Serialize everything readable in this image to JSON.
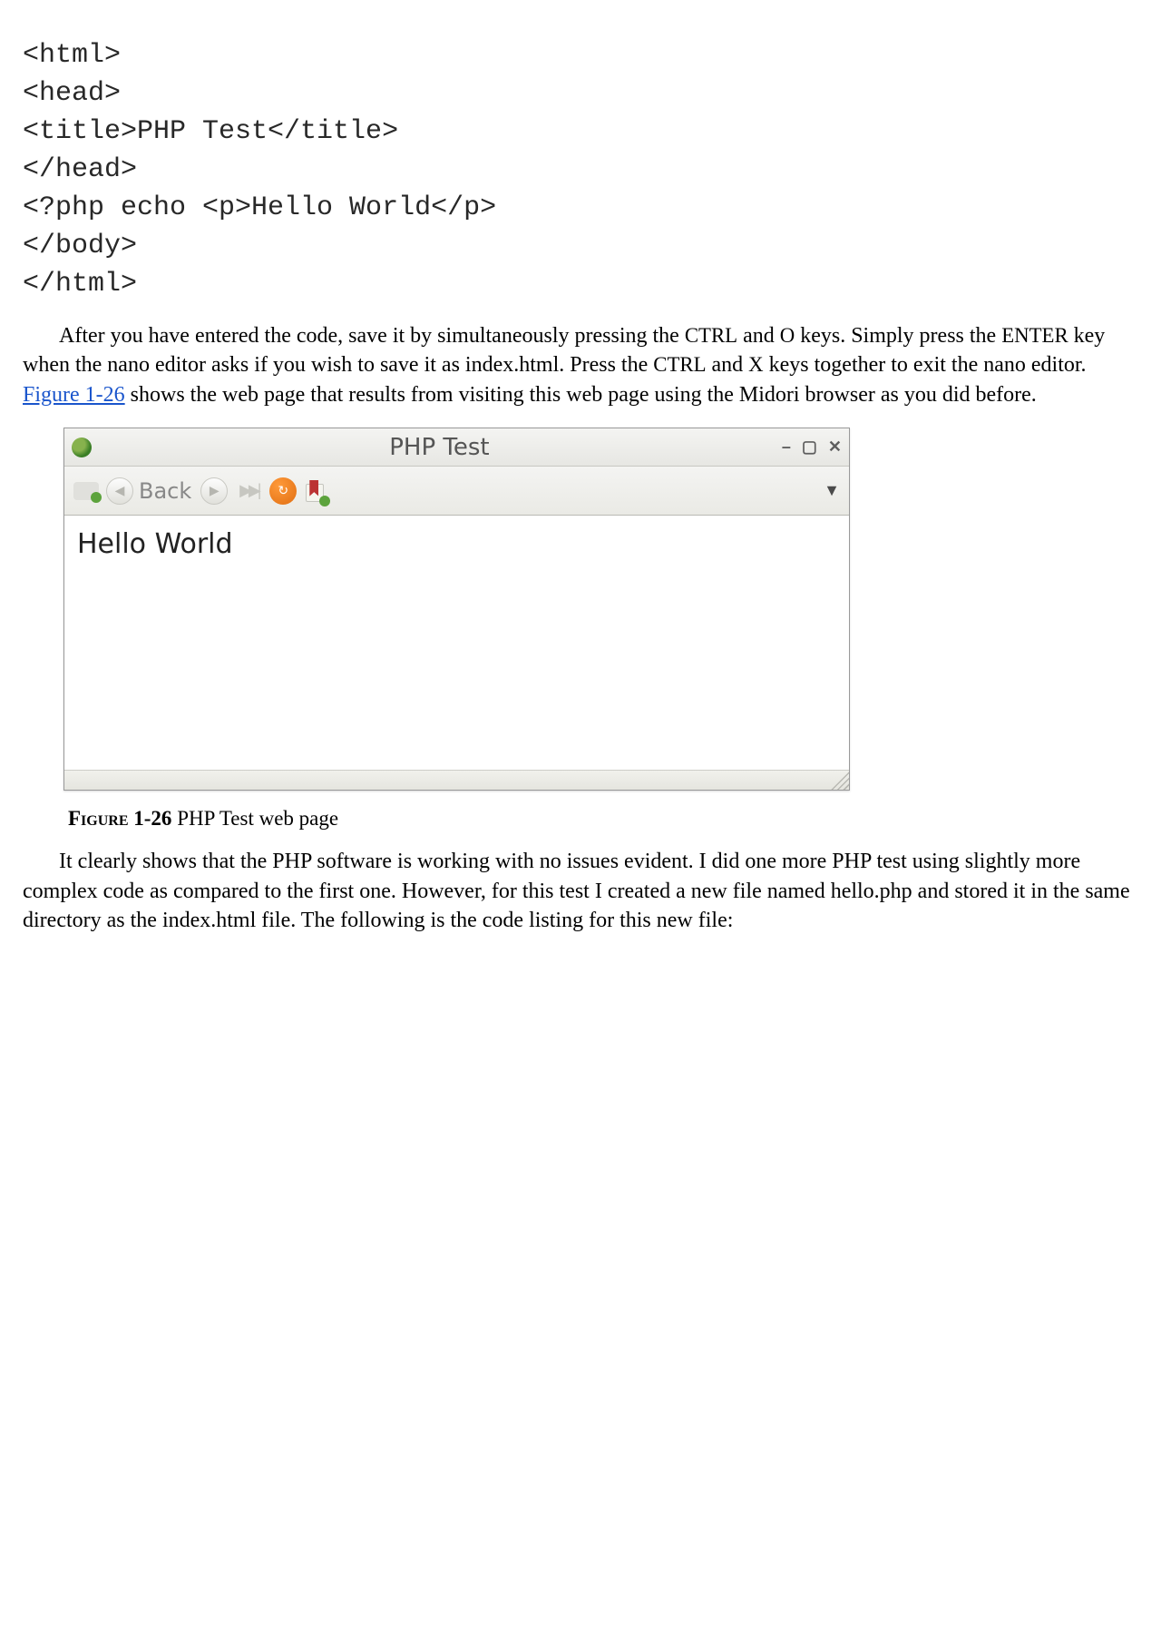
{
  "code": {
    "line1": "<html>",
    "line2": "<head>",
    "line3": "<title>PHP Test</title>",
    "line4": "</head>",
    "line5": "<?php echo <p>Hello World</p>",
    "line6": "</body>",
    "line7": "</html>"
  },
  "para1": {
    "part1": "After you have entered the code, save it by simultaneously pressing the ",
    "k_ctrl1": "CTRL",
    "part2": " and ",
    "k_o": "O",
    "part3": " keys. Simply press the ",
    "k_enter": "ENTER",
    "part4": " key when the nano editor asks if you wish to save it as index.html. Press the ",
    "k_ctrl2": "CTRL",
    "part5": " and ",
    "k_x": "X",
    "part6": " keys together to exit the nano editor. ",
    "link_text": "Figure 1-26",
    "part7": " shows the web page that results from visiting this web page using the Midori browser as you did before."
  },
  "browser": {
    "title": "PHP Test",
    "back_label": "Back",
    "content": "Hello World",
    "win_minimize": "–",
    "win_maximize": "▢",
    "win_close": "✕",
    "menu_chevron": "▼"
  },
  "caption": {
    "label": "Figure",
    "num": " 1-26 ",
    "text": "PHP Test web page"
  },
  "para2": "It clearly shows that the PHP software is working with no issues evident. I did one more PHP test using slightly more complex code as compared to the first one. However, for this test I created a new file named hello.php and stored it in the same directory as the index.html file. The following is the code listing for this new file:"
}
